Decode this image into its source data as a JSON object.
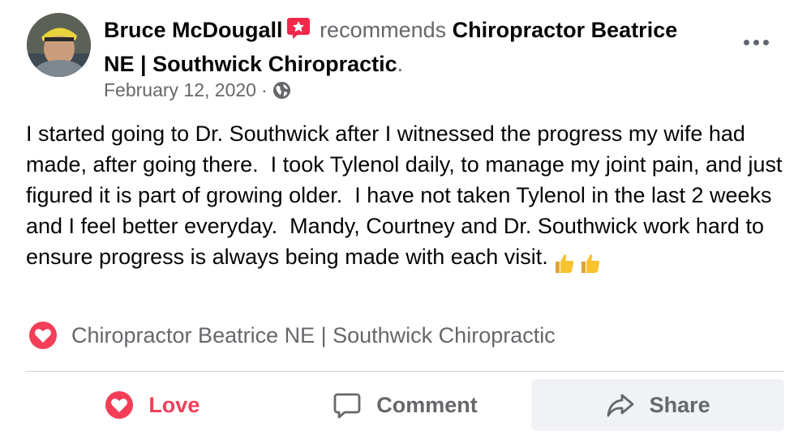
{
  "post": {
    "author": "Bruce McDougall",
    "action_text": "recommends",
    "page_name": "Chiropractor Beatrice NE | Southwick Chiropractic",
    "period": ".",
    "date": "February 12, 2020",
    "separator": "·",
    "body": "I started going to Dr. Southwick after I witnessed the progress my wife had made, after going there.  I took Tylenol daily, to manage my joint pain, and just figured it is part of growing older.  I have not taken Tylenol in the last 2 weeks and I feel better everyday.  Mandy, Courtney and Dr. Southwick work hard to ensure progress is always being made with each visit.",
    "recommendation_page": "Chiropractor Beatrice NE | Southwick Chiropractic"
  },
  "icons": {
    "badge": "recommend-badge-icon",
    "privacy": "globe-icon",
    "more": "more-options-icon",
    "thumbs": "thumbs-up-emoji-icon",
    "reaction": "love-heart-icon",
    "comment": "comment-bubble-icon",
    "share": "share-arrow-icon"
  },
  "actions": {
    "love_label": "Love",
    "comment_label": "Comment",
    "share_label": "Share"
  },
  "colors": {
    "love": "#f33e58",
    "secondary_text": "#65676b",
    "share_bg": "#f0f2f5"
  }
}
